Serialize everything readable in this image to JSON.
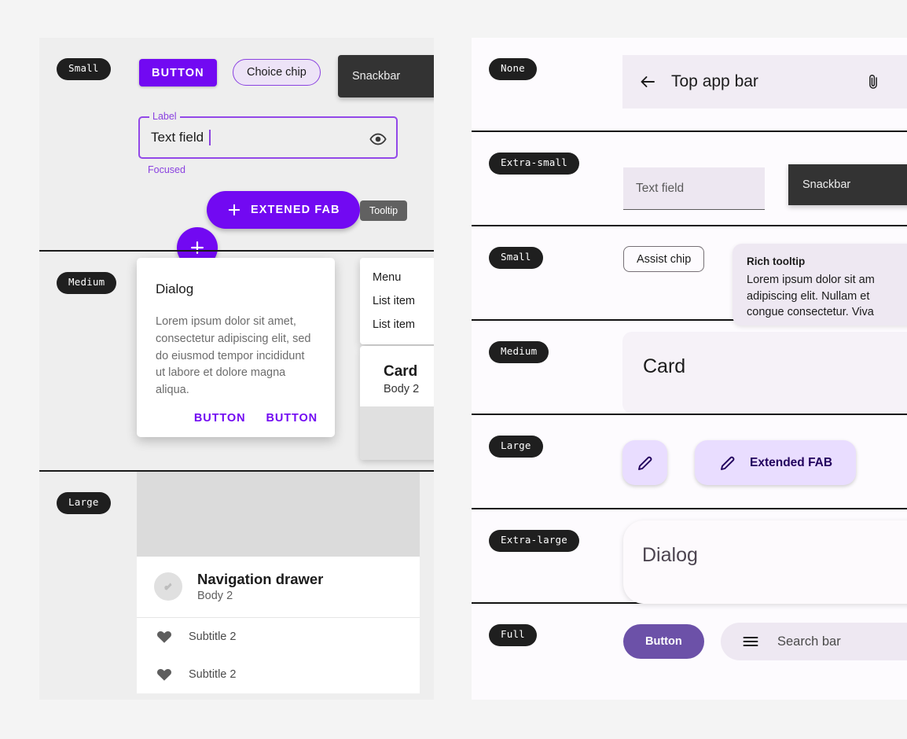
{
  "left_panel": {
    "rows": [
      {
        "badge": "Small",
        "button_label": "BUTTON",
        "choice_chip_label": "Choice chip",
        "snackbar_label": "Snackbar",
        "textfield": {
          "label": "Label",
          "value": "Text field",
          "helper": "Focused",
          "trailing_icon": "eye-icon"
        },
        "fab_icon": "plus-icon",
        "extended_fab_label": "EXTENED FAB",
        "extended_fab_icon": "plus-icon",
        "tooltip_label": "Tooltip"
      },
      {
        "badge": "Medium",
        "dialog": {
          "title": "Dialog",
          "body": "Lorem ipsum dolor sit amet, consectetur adipiscing elit, sed do eiusmod tempor incididunt ut labore et dolore magna aliqua.",
          "button_1": "BUTTON",
          "button_2": "BUTTON"
        },
        "menu": {
          "header": "Menu",
          "items": [
            "List item",
            "List item"
          ]
        },
        "card": {
          "title": "Card",
          "body": "Body 2"
        }
      },
      {
        "badge": "Large",
        "drawer": {
          "title": "Navigation drawer",
          "subtitle": "Body 2",
          "items": [
            {
              "icon": "heart-icon",
              "label": "Subtitle 2"
            },
            {
              "icon": "heart-icon",
              "label": "Subtitle 2"
            }
          ]
        }
      }
    ]
  },
  "right_panel": {
    "rows": [
      {
        "badge": "None",
        "appbar": {
          "back_icon": "arrow-left-icon",
          "title": "Top app bar",
          "action_icon": "attachment-icon"
        }
      },
      {
        "badge": "Extra-small",
        "textfield_placeholder": "Text field",
        "snackbar_label": "Snackbar"
      },
      {
        "badge": "Small",
        "assist_chip_label": "Assist chip",
        "rich_tooltip": {
          "title": "Rich tooltip",
          "body_line_1": "Lorem ipsum dolor sit am",
          "body_line_2": "adipiscing elit. Nullam et",
          "body_line_3": "congue consectetur. Viva"
        }
      },
      {
        "badge": "Medium",
        "card_title": "Card"
      },
      {
        "badge": "Large",
        "fab_icon": "pencil-icon",
        "extended_fab_label": "Extended FAB",
        "extended_fab_icon": "pencil-icon"
      },
      {
        "badge": "Extra-large",
        "dialog_title": "Dialog"
      },
      {
        "badge": "Full",
        "button_label": "Button",
        "searchbar": {
          "menu_icon": "hamburger-icon",
          "placeholder": "Search bar"
        }
      }
    ]
  },
  "colors": {
    "page_background": "#F4F4F4",
    "left_panel_background": "#EEEEEE",
    "right_panel_background": "#FDFBFE",
    "primary_purple": "#7209F2",
    "badge_dark": "#1F1F1F",
    "snackbar_dark": "#333333",
    "tooltip_gray": "#616161",
    "fab_container_light": "#E9DDFF",
    "fab_on_container": "#21005D",
    "appbar_surface": "#F1ECF4",
    "full_button": "#6C51A8"
  }
}
